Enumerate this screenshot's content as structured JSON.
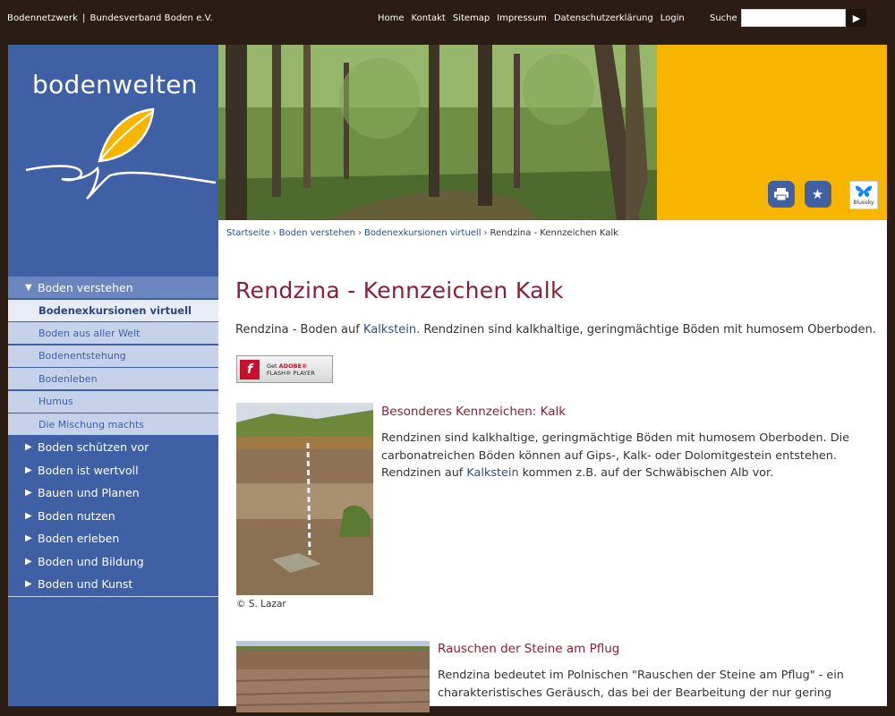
{
  "header": {
    "brand_left": "Bodennetzwerk",
    "brand_sep": "|",
    "brand_right": "Bundesverband Boden e.V.",
    "nav": [
      "Home",
      "Kontakt",
      "Sitemap",
      "Impressum",
      "Datenschutzerklärung",
      "Login"
    ],
    "search_label": "Suche",
    "search_value": "",
    "search_button": "▶"
  },
  "logo": {
    "text": "bodenwelten"
  },
  "sidebar": {
    "open_item": "Boden verstehen",
    "sub_items": [
      {
        "label": "Bodenexkursionen virtuell",
        "active": true
      },
      {
        "label": "Boden aus aller Welt",
        "active": false
      },
      {
        "label": "Bodenentstehung",
        "active": false
      },
      {
        "label": "Bodenleben",
        "active": false
      },
      {
        "label": "Humus",
        "active": false
      },
      {
        "label": "Die Mischung machts",
        "active": false
      }
    ],
    "items": [
      "Boden schützen vor",
      "Boden ist wertvoll",
      "Bauen und Planen",
      "Boden nutzen",
      "Boden erleben",
      "Boden und Bildung",
      "Boden und Kunst"
    ],
    "open_arrow": "▼",
    "closed_arrow": "▶"
  },
  "toolbar": {
    "print_icon": "print-icon",
    "bookmark_icon": "star-icon",
    "bluesky_label": "Bluesky"
  },
  "breadcrumb": {
    "items": [
      "Startseite",
      "Boden verstehen",
      "Bodenexkursionen virtuell"
    ],
    "current": "Rendzina - Kennzeichen Kalk",
    "separator": "›"
  },
  "article": {
    "title": "Rendzina - Kennzeichen Kalk",
    "intro_pre": "Rendzina - Boden auf ",
    "intro_link": "Kalkstein",
    "intro_post": ". Rendzinen sind kalkhaltige, geringmächtige Böden mit humosem Oberboden.",
    "flash": {
      "line1_pre": "Get ",
      "line1_brand": "ADOBE®",
      "line2": "FLASH® PLAYER"
    },
    "section1": {
      "heading": "Besonderes Kennzeichen: Kalk",
      "text_1": "Rendzinen sind kalkhaltige, geringmächtige Böden mit humosem Oberboden. Die carbonatreichen Böden können auf Gips-, Kalk- oder Dolomitgestein entstehen. Rendzinen auf ",
      "link": "Kalkstein",
      "text_2": " kommen z.B. auf der Schwäbischen Alb vor.",
      "credit": "© S. Lazar"
    },
    "section2": {
      "heading": "Rauschen der Steine am Pflug",
      "text": "Rendzina bedeutet im Polnischen \"Rauschen der Steine am Pflug\" - ein charakteristisches Geräusch, das bei der Bearbeitung der nur gering"
    }
  },
  "colors": {
    "topbar": "#2b1d14",
    "sidebar": "#3f60a4",
    "accent_yellow": "#f7b500",
    "heading": "#8a1f32",
    "link": "#2a4f8a"
  }
}
